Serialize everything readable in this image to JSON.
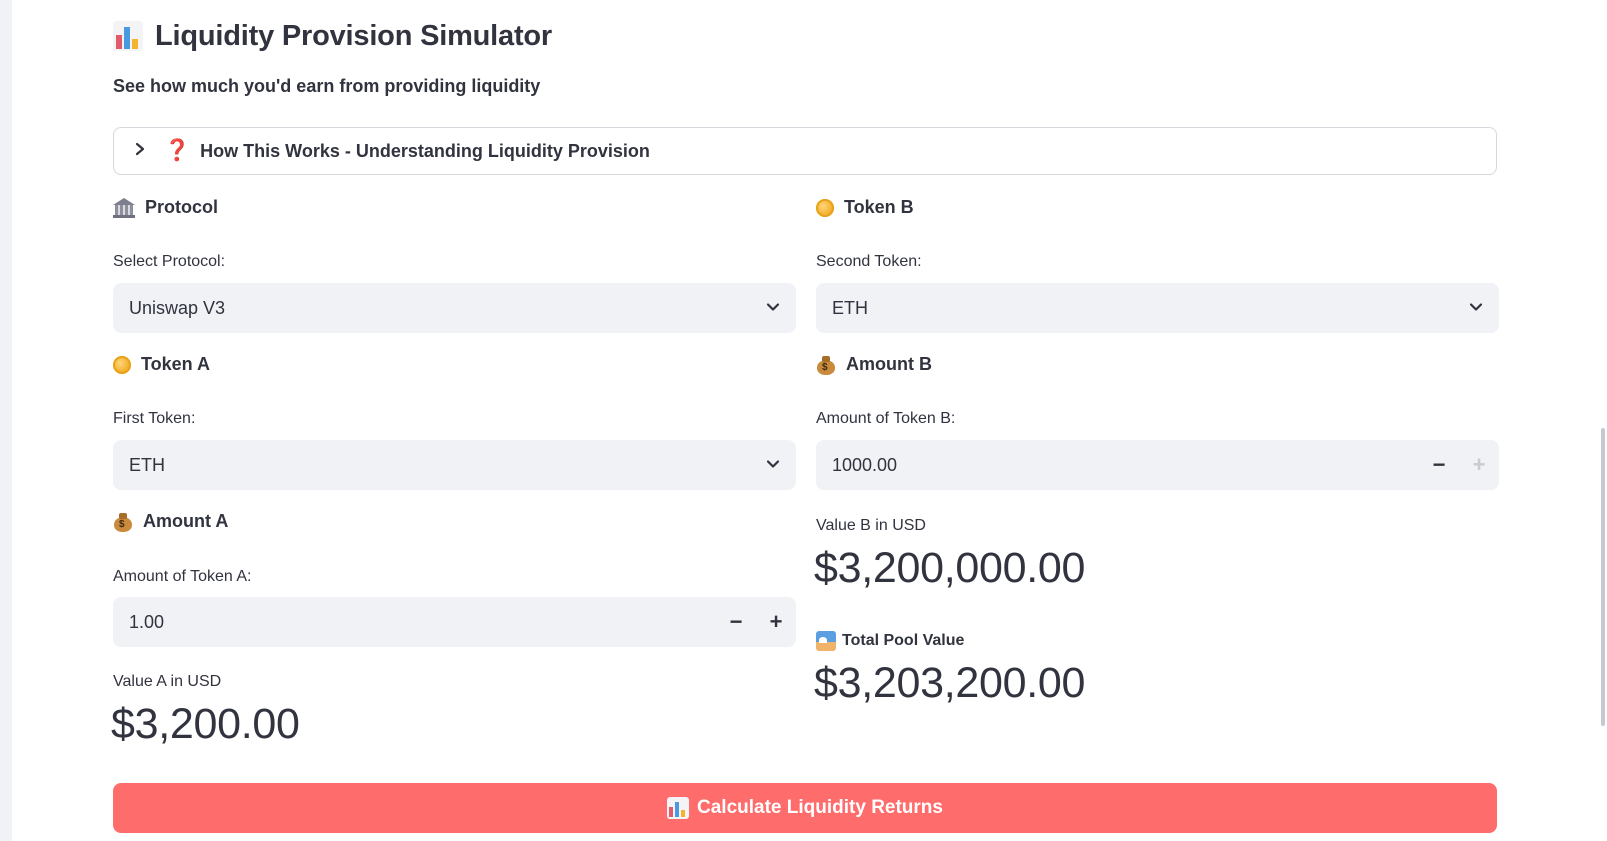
{
  "page": {
    "title": "Liquidity Provision Simulator",
    "title_icon": "bar-chart-icon",
    "subtitle": "See how much you'd earn from providing liquidity"
  },
  "expander": {
    "label": "How This Works - Understanding Liquidity Provision",
    "icon": "question-mark-icon",
    "question_glyph": "❓",
    "chevron_glyph": "›"
  },
  "left": {
    "protocol": {
      "section_title": "Protocol",
      "icon": "bank-icon",
      "field_label": "Select Protocol:",
      "value": "Uniswap V3"
    },
    "token_a": {
      "section_title": "Token A",
      "icon": "coin-icon",
      "field_label": "First Token:",
      "value": "ETH"
    },
    "amount_a": {
      "section_title": "Amount A",
      "icon": "money-bag-icon",
      "field_label": "Amount of Token A:",
      "value": "1.00",
      "minus": "−",
      "plus": "+"
    },
    "value_a": {
      "label": "Value A in USD",
      "value": "$3,200.00"
    }
  },
  "right": {
    "token_b": {
      "section_title": "Token B",
      "icon": "coin-icon",
      "field_label": "Second Token:",
      "value": "ETH"
    },
    "amount_b": {
      "section_title": "Amount B",
      "icon": "money-bag-icon",
      "field_label": "Amount of Token B:",
      "value": "1000.00",
      "minus": "−",
      "plus": "+"
    },
    "value_b": {
      "label": "Value B in USD",
      "value": "$3,200,000.00"
    },
    "total": {
      "label": "Total Pool Value",
      "icon": "pool-icon",
      "value": "$3,203,200.00"
    }
  },
  "calculate_button": {
    "label": "Calculate Liquidity Returns",
    "icon": "bar-chart-icon"
  },
  "colors": {
    "primary_button": "#ff6c6c",
    "input_bg": "#f0f2f6",
    "text": "#31333f"
  }
}
